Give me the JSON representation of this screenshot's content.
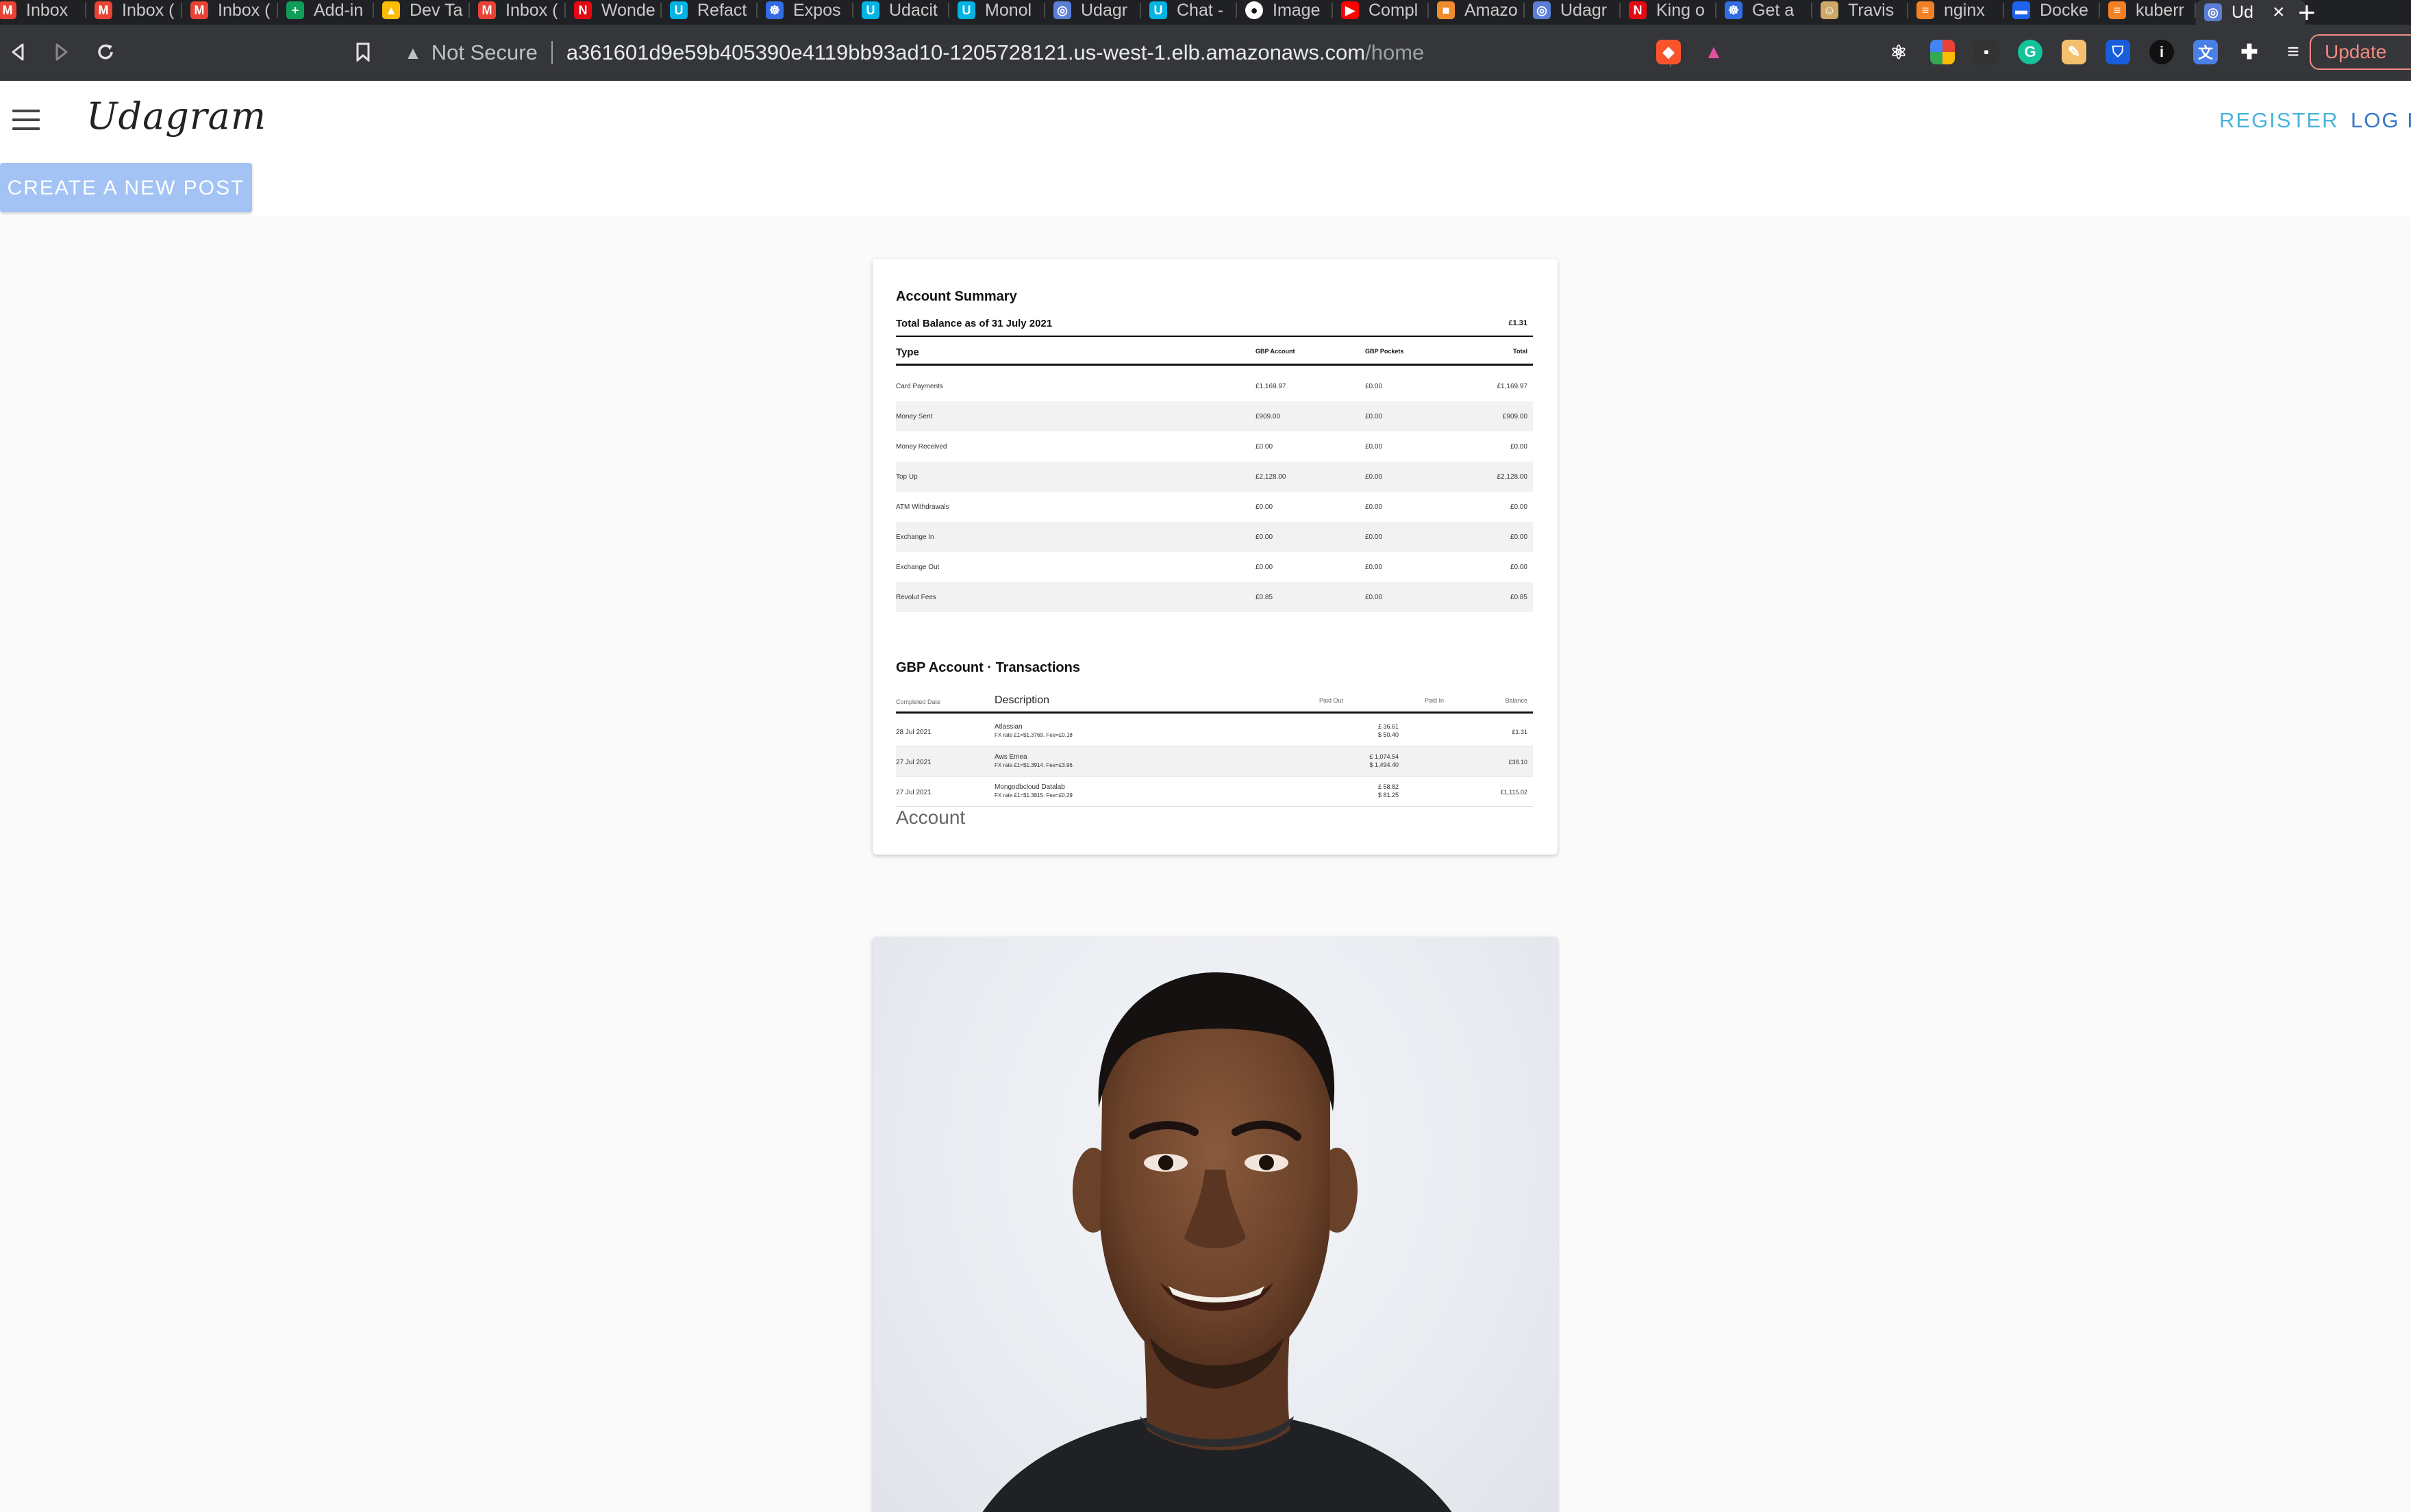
{
  "browser": {
    "tabs": [
      {
        "label": "Inbox",
        "icon": "gmail-icon"
      },
      {
        "label": "Inbox (",
        "icon": "gmail-icon"
      },
      {
        "label": "Inbox (",
        "icon": "gmail-icon"
      },
      {
        "label": "Add-in",
        "icon": "sheets-icon"
      },
      {
        "label": "Dev Ta",
        "icon": "drive-icon"
      },
      {
        "label": "Inbox (",
        "icon": "gmail-icon"
      },
      {
        "label": "Wonde",
        "icon": "netflix-icon"
      },
      {
        "label": "Refact",
        "icon": "udacity-icon"
      },
      {
        "label": "Expos",
        "icon": "kubernetes-icon"
      },
      {
        "label": "Udacit",
        "icon": "udacity-icon"
      },
      {
        "label": "Monol",
        "icon": "udacity-icon"
      },
      {
        "label": "Udagr",
        "icon": "globe-icon"
      },
      {
        "label": "Chat -",
        "icon": "udacity-icon"
      },
      {
        "label": "Image",
        "icon": "github-icon"
      },
      {
        "label": "Compl",
        "icon": "youtube-icon"
      },
      {
        "label": "Amazo",
        "icon": "aws-icon"
      },
      {
        "label": "Udagr",
        "icon": "globe-icon"
      },
      {
        "label": "King o",
        "icon": "netflix-icon"
      },
      {
        "label": "Get a",
        "icon": "kubernetes-icon"
      },
      {
        "label": "Travis",
        "icon": "travis-icon"
      },
      {
        "label": "nginx",
        "icon": "stackoverflow-icon"
      },
      {
        "label": "Docke",
        "icon": "docker-icon"
      },
      {
        "label": "kuberr",
        "icon": "stackoverflow-icon"
      },
      {
        "label": "Ud",
        "icon": "globe-icon",
        "active": true
      }
    ],
    "security_label": "Not Secure",
    "url_host": "a361601d9e59b405390e4119bb93ad10-1205728121.us-west-1.elb.amazonaws.com",
    "url_path": "/home",
    "update_label": "Update"
  },
  "app": {
    "brand": "Udagram",
    "register_label": "REGISTER",
    "login_label": "LOG IN",
    "create_post_label": "CREATE A NEW POST",
    "accent_color": "#48b5d9"
  },
  "feed": {
    "post1": {
      "caption": "Account",
      "statement": {
        "title": "Account Summary",
        "balance_label": "Total Balance as of 31 July 2021",
        "balance_value": "£1.31",
        "headers": [
          "Type",
          "GBP Account",
          "GBP Pockets",
          "Total"
        ],
        "rows": [
          [
            "Card Payments",
            "£1,169.97",
            "£0.00",
            "£1,169.97"
          ],
          [
            "Money Sent",
            "£909.00",
            "£0.00",
            "£909.00"
          ],
          [
            "Money Received",
            "£0.00",
            "£0.00",
            "£0.00"
          ],
          [
            "Top Up",
            "£2,128.00",
            "£0.00",
            "£2,128.00"
          ],
          [
            "ATM Withdrawals",
            "£0.00",
            "£0.00",
            "£0.00"
          ],
          [
            "Exchange In",
            "£0.00",
            "£0.00",
            "£0.00"
          ],
          [
            "Exchange Out",
            "£0.00",
            "£0.00",
            "£0.00"
          ],
          [
            "Revolut Fees",
            "£0.85",
            "£0.00",
            "£0.85"
          ]
        ],
        "tx_title": "GBP Account · Transactions",
        "tx_headers": [
          "Completed Date",
          "Description",
          "Paid Out",
          "Paid In",
          "Balance"
        ],
        "transactions": [
          {
            "date": "28 Jul 2021",
            "desc": "Atlassian",
            "sub": "FX rate £1=$1.3769. Fee=£0.18",
            "out1": "£ 36.61",
            "out2": "$ 50.40",
            "balance": "£1.31"
          },
          {
            "date": "27 Jul 2021",
            "desc": "Aws Emea",
            "sub": "FX rate £1=$1.3914. Fee=£3.96",
            "out1": "£ 1,074.54",
            "out2": "$ 1,494.40",
            "balance": "£38.10"
          },
          {
            "date": "27 Jul 2021",
            "desc": "Mongodbcloud Datalab",
            "sub": "FX rate £1=$1.3815. Fee=£0.29",
            "out1": "£ 58.82",
            "out2": "$ 81.25",
            "balance": "£1,115.02"
          }
        ]
      }
    }
  }
}
